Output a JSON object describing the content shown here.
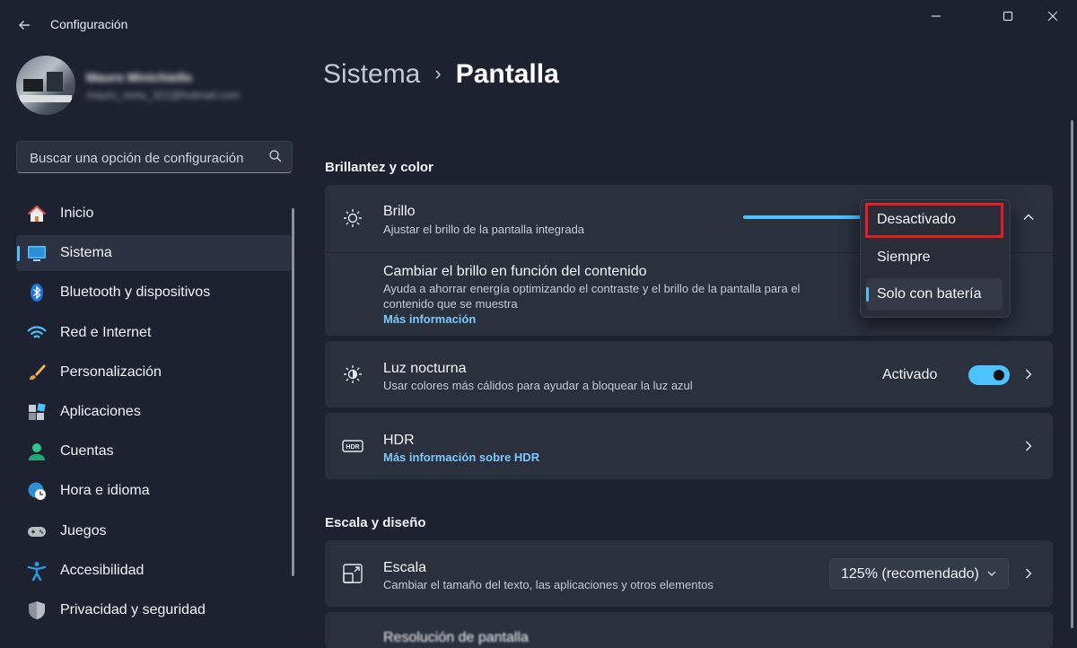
{
  "window": {
    "title": "Configuración"
  },
  "user": {
    "name": "Mauro Minichiello",
    "email": "mauro_mmu_321@hotmail.com"
  },
  "search": {
    "placeholder": "Buscar una opción de configuración"
  },
  "nav": {
    "items": [
      {
        "label": "Inicio",
        "icon": "home-icon"
      },
      {
        "label": "Sistema",
        "icon": "monitor-icon",
        "selected": true
      },
      {
        "label": "Bluetooth y dispositivos",
        "icon": "bluetooth-icon"
      },
      {
        "label": "Red e Internet",
        "icon": "wifi-icon"
      },
      {
        "label": "Personalización",
        "icon": "brush-icon"
      },
      {
        "label": "Aplicaciones",
        "icon": "apps-icon"
      },
      {
        "label": "Cuentas",
        "icon": "person-icon"
      },
      {
        "label": "Hora e idioma",
        "icon": "globe-clock-icon"
      },
      {
        "label": "Juegos",
        "icon": "gamepad-icon"
      },
      {
        "label": "Accesibilidad",
        "icon": "accessibility-icon"
      },
      {
        "label": "Privacidad y seguridad",
        "icon": "shield-icon"
      }
    ]
  },
  "breadcrumb": {
    "parent": "Sistema",
    "current": "Pantalla"
  },
  "sections": {
    "brightness": "Brillantez y color",
    "scale": "Escala y diseño"
  },
  "brightness": {
    "title": "Brillo",
    "subtitle": "Ajustar el brillo de la pantalla integrada",
    "level": 0.75,
    "content_title": "Cambiar el brillo en función del contenido",
    "content_sub_1": "Ayuda a ahorrar energía optimizando el contraste y el brillo de la pantalla para el",
    "content_sub_2": "contenido que se muestra",
    "content_link": "Más información",
    "dropdown": {
      "options": [
        "Desactivado",
        "Siempre",
        "Solo con batería"
      ],
      "selected": "Solo con batería",
      "highlighted": "Desactivado"
    }
  },
  "night_light": {
    "title": "Luz nocturna",
    "subtitle": "Usar colores más cálidos para ayudar a bloquear la luz azul",
    "state_label": "Activado",
    "on": true
  },
  "hdr": {
    "title": "HDR",
    "link": "Más información sobre HDR"
  },
  "scale": {
    "title": "Escala",
    "subtitle": "Cambiar el tamaño del texto, las aplicaciones y otros elementos",
    "value": "125% (recomendado)"
  },
  "resolution": {
    "title": "Resolución de pantalla"
  },
  "colors": {
    "accent": "#4cc2ff",
    "highlight_box": "#e01e26",
    "background": "#1e2230",
    "card": "#2b303d"
  }
}
